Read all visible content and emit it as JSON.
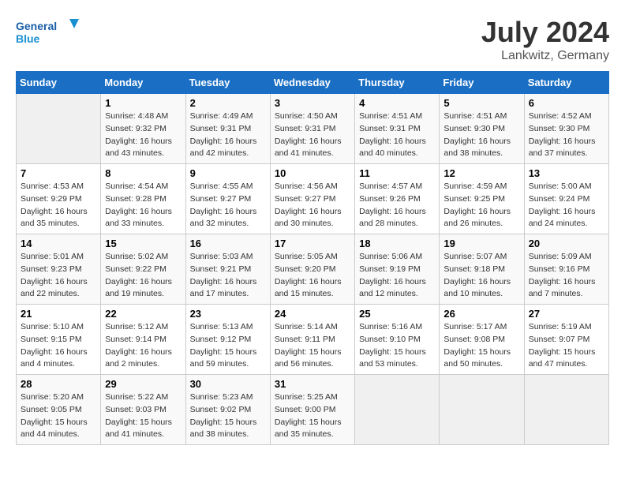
{
  "header": {
    "logo_text_general": "General",
    "logo_text_blue": "Blue",
    "month_year": "July 2024",
    "location": "Lankwitz, Germany"
  },
  "days_of_week": [
    "Sunday",
    "Monday",
    "Tuesday",
    "Wednesday",
    "Thursday",
    "Friday",
    "Saturday"
  ],
  "weeks": [
    [
      {
        "day": "",
        "empty": true
      },
      {
        "day": "1",
        "sunrise": "4:48 AM",
        "sunset": "9:32 PM",
        "daylight": "16 hours and 43 minutes."
      },
      {
        "day": "2",
        "sunrise": "4:49 AM",
        "sunset": "9:31 PM",
        "daylight": "16 hours and 42 minutes."
      },
      {
        "day": "3",
        "sunrise": "4:50 AM",
        "sunset": "9:31 PM",
        "daylight": "16 hours and 41 minutes."
      },
      {
        "day": "4",
        "sunrise": "4:51 AM",
        "sunset": "9:31 PM",
        "daylight": "16 hours and 40 minutes."
      },
      {
        "day": "5",
        "sunrise": "4:51 AM",
        "sunset": "9:30 PM",
        "daylight": "16 hours and 38 minutes."
      },
      {
        "day": "6",
        "sunrise": "4:52 AM",
        "sunset": "9:30 PM",
        "daylight": "16 hours and 37 minutes."
      }
    ],
    [
      {
        "day": "7",
        "sunrise": "4:53 AM",
        "sunset": "9:29 PM",
        "daylight": "16 hours and 35 minutes."
      },
      {
        "day": "8",
        "sunrise": "4:54 AM",
        "sunset": "9:28 PM",
        "daylight": "16 hours and 33 minutes."
      },
      {
        "day": "9",
        "sunrise": "4:55 AM",
        "sunset": "9:27 PM",
        "daylight": "16 hours and 32 minutes."
      },
      {
        "day": "10",
        "sunrise": "4:56 AM",
        "sunset": "9:27 PM",
        "daylight": "16 hours and 30 minutes."
      },
      {
        "day": "11",
        "sunrise": "4:57 AM",
        "sunset": "9:26 PM",
        "daylight": "16 hours and 28 minutes."
      },
      {
        "day": "12",
        "sunrise": "4:59 AM",
        "sunset": "9:25 PM",
        "daylight": "16 hours and 26 minutes."
      },
      {
        "day": "13",
        "sunrise": "5:00 AM",
        "sunset": "9:24 PM",
        "daylight": "16 hours and 24 minutes."
      }
    ],
    [
      {
        "day": "14",
        "sunrise": "5:01 AM",
        "sunset": "9:23 PM",
        "daylight": "16 hours and 22 minutes."
      },
      {
        "day": "15",
        "sunrise": "5:02 AM",
        "sunset": "9:22 PM",
        "daylight": "16 hours and 19 minutes."
      },
      {
        "day": "16",
        "sunrise": "5:03 AM",
        "sunset": "9:21 PM",
        "daylight": "16 hours and 17 minutes."
      },
      {
        "day": "17",
        "sunrise": "5:05 AM",
        "sunset": "9:20 PM",
        "daylight": "16 hours and 15 minutes."
      },
      {
        "day": "18",
        "sunrise": "5:06 AM",
        "sunset": "9:19 PM",
        "daylight": "16 hours and 12 minutes."
      },
      {
        "day": "19",
        "sunrise": "5:07 AM",
        "sunset": "9:18 PM",
        "daylight": "16 hours and 10 minutes."
      },
      {
        "day": "20",
        "sunrise": "5:09 AM",
        "sunset": "9:16 PM",
        "daylight": "16 hours and 7 minutes."
      }
    ],
    [
      {
        "day": "21",
        "sunrise": "5:10 AM",
        "sunset": "9:15 PM",
        "daylight": "16 hours and 4 minutes."
      },
      {
        "day": "22",
        "sunrise": "5:12 AM",
        "sunset": "9:14 PM",
        "daylight": "16 hours and 2 minutes."
      },
      {
        "day": "23",
        "sunrise": "5:13 AM",
        "sunset": "9:12 PM",
        "daylight": "15 hours and 59 minutes."
      },
      {
        "day": "24",
        "sunrise": "5:14 AM",
        "sunset": "9:11 PM",
        "daylight": "15 hours and 56 minutes."
      },
      {
        "day": "25",
        "sunrise": "5:16 AM",
        "sunset": "9:10 PM",
        "daylight": "15 hours and 53 minutes."
      },
      {
        "day": "26",
        "sunrise": "5:17 AM",
        "sunset": "9:08 PM",
        "daylight": "15 hours and 50 minutes."
      },
      {
        "day": "27",
        "sunrise": "5:19 AM",
        "sunset": "9:07 PM",
        "daylight": "15 hours and 47 minutes."
      }
    ],
    [
      {
        "day": "28",
        "sunrise": "5:20 AM",
        "sunset": "9:05 PM",
        "daylight": "15 hours and 44 minutes."
      },
      {
        "day": "29",
        "sunrise": "5:22 AM",
        "sunset": "9:03 PM",
        "daylight": "15 hours and 41 minutes."
      },
      {
        "day": "30",
        "sunrise": "5:23 AM",
        "sunset": "9:02 PM",
        "daylight": "15 hours and 38 minutes."
      },
      {
        "day": "31",
        "sunrise": "5:25 AM",
        "sunset": "9:00 PM",
        "daylight": "15 hours and 35 minutes."
      },
      {
        "day": "",
        "empty": true
      },
      {
        "day": "",
        "empty": true
      },
      {
        "day": "",
        "empty": true
      }
    ]
  ]
}
